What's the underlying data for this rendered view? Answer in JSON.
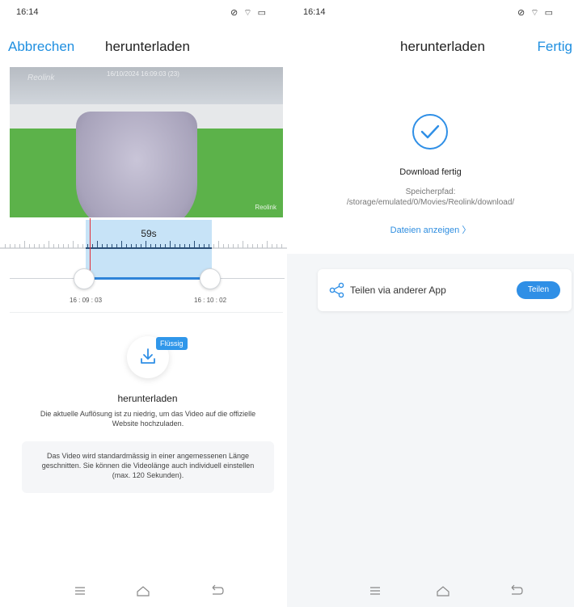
{
  "left": {
    "status": {
      "time": "16:14",
      "right_icons": "⊘ ⌔ ▭"
    },
    "nav": {
      "cancel_label": "Abbrechen",
      "title": "herunterladen"
    },
    "video": {
      "osd_left": "Reolink",
      "osd_time": "16/10/2024 16:09:03 (23)",
      "osd_right": "Reolink"
    },
    "timeline": {
      "duration": "59s",
      "start_time": "16 : 09 : 03",
      "end_time": "16 : 10 : 02"
    },
    "download": {
      "badge": "Flüssig",
      "title": "herunterladen",
      "description": "Die aktuelle Auflösung ist zu niedrig, um das Video auf die offizielle Website hochzuladen.",
      "info": "Das Video wird standardmässig in einer angemessenen Länge geschnitten. Sie können die Videolänge auch individuell einstellen (max. 120 Sekunden)."
    }
  },
  "right": {
    "status": {
      "time": "16:14",
      "right_icons": "⊘ ⌔ ▭"
    },
    "nav": {
      "title": "herunterladen",
      "done_label": "Fertig"
    },
    "result": {
      "title": "Download fertig",
      "path_label": "Speicherpfad:",
      "path_value": "/storage/emulated/0/Movies/Reolink/download/",
      "files_link": "Dateien anzeigen  〉"
    },
    "share": {
      "label": "Teilen via anderer App",
      "button": "Teilen"
    }
  },
  "colors": {
    "accent": "#2f8fe6",
    "playhead": "#e0303a",
    "selection": "#c7e3f7"
  },
  "icons": [
    "download-icon",
    "check-circle-icon",
    "share-icon",
    "menu-icon",
    "home-icon",
    "back-icon"
  ]
}
